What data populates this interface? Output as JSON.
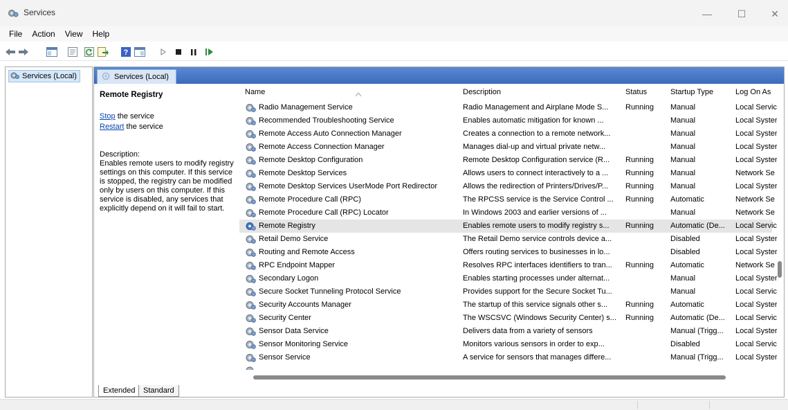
{
  "window": {
    "title": "Services",
    "minimize": "—",
    "maximize": "☐",
    "close": "✕"
  },
  "menu": [
    "File",
    "Action",
    "View",
    "Help"
  ],
  "toolbar_icons": [
    "back-icon",
    "forward-icon",
    "show-hide-console-tree-icon",
    "properties-icon",
    "refresh-icon",
    "export-list-icon",
    "help-icon",
    "show-hide-action-pane-icon",
    "start-service-icon",
    "stop-service-icon",
    "pause-service-icon",
    "resume-service-icon"
  ],
  "tree": {
    "root_label": "Services (Local)"
  },
  "header": {
    "title": "Services (Local)"
  },
  "details": {
    "title": "Remote Registry",
    "stop_link": "Stop",
    "stop_suffix": " the service",
    "restart_link": "Restart",
    "restart_suffix": " the service",
    "description_label": "Description:",
    "description_text": "Enables remote users to modify registry settings on this computer. If this service is stopped, the registry can be modified only by users on this computer. If this service is disabled, any services that explicitly depend on it will fail to start."
  },
  "table": {
    "columns": {
      "name": "Name",
      "description": "Description",
      "status": "Status",
      "startup": "Startup Type",
      "logon": "Log On As"
    },
    "selected_index": 9,
    "rows": [
      {
        "name": "Radio Management Service",
        "description": "Radio Management and Airplane Mode S...",
        "status": "Running",
        "startup": "Manual",
        "logon": "Local Servic"
      },
      {
        "name": "Recommended Troubleshooting Service",
        "description": "Enables automatic mitigation for known ...",
        "status": "",
        "startup": "Manual",
        "logon": "Local Syster"
      },
      {
        "name": "Remote Access Auto Connection Manager",
        "description": "Creates a connection to a remote network...",
        "status": "",
        "startup": "Manual",
        "logon": "Local Syster"
      },
      {
        "name": "Remote Access Connection Manager",
        "description": "Manages dial-up and virtual private netw...",
        "status": "",
        "startup": "Manual",
        "logon": "Local Syster"
      },
      {
        "name": "Remote Desktop Configuration",
        "description": "Remote Desktop Configuration service (R...",
        "status": "Running",
        "startup": "Manual",
        "logon": "Local Syster"
      },
      {
        "name": "Remote Desktop Services",
        "description": "Allows users to connect interactively to a ...",
        "status": "Running",
        "startup": "Manual",
        "logon": "Network Se"
      },
      {
        "name": "Remote Desktop Services UserMode Port Redirector",
        "description": "Allows the redirection of Printers/Drives/P...",
        "status": "Running",
        "startup": "Manual",
        "logon": "Local Syster"
      },
      {
        "name": "Remote Procedure Call (RPC)",
        "description": "The RPCSS service is the Service Control ...",
        "status": "Running",
        "startup": "Automatic",
        "logon": "Network Se"
      },
      {
        "name": "Remote Procedure Call (RPC) Locator",
        "description": "In Windows 2003 and earlier versions of ...",
        "status": "",
        "startup": "Manual",
        "logon": "Network Se"
      },
      {
        "name": "Remote Registry",
        "description": "Enables remote users to modify registry s...",
        "status": "Running",
        "startup": "Automatic (De...",
        "logon": "Local Servic"
      },
      {
        "name": "Retail Demo Service",
        "description": "The Retail Demo service controls device a...",
        "status": "",
        "startup": "Disabled",
        "logon": "Local Syster"
      },
      {
        "name": "Routing and Remote Access",
        "description": "Offers routing services to businesses in lo...",
        "status": "",
        "startup": "Disabled",
        "logon": "Local Syster"
      },
      {
        "name": "RPC Endpoint Mapper",
        "description": "Resolves RPC interfaces identifiers to tran...",
        "status": "Running",
        "startup": "Automatic",
        "logon": "Network Se"
      },
      {
        "name": "Secondary Logon",
        "description": "Enables starting processes under alternat...",
        "status": "",
        "startup": "Manual",
        "logon": "Local Syster"
      },
      {
        "name": "Secure Socket Tunneling Protocol Service",
        "description": "Provides support for the Secure Socket Tu...",
        "status": "",
        "startup": "Manual",
        "logon": "Local Servic"
      },
      {
        "name": "Security Accounts Manager",
        "description": "The startup of this service signals other s...",
        "status": "Running",
        "startup": "Automatic",
        "logon": "Local Syster"
      },
      {
        "name": "Security Center",
        "description": "The WSCSVC (Windows Security Center) s...",
        "status": "Running",
        "startup": "Automatic (De...",
        "logon": "Local Servic"
      },
      {
        "name": "Sensor Data Service",
        "description": "Delivers data from a variety of sensors",
        "status": "",
        "startup": "Manual (Trigg...",
        "logon": "Local Syster"
      },
      {
        "name": "Sensor Monitoring Service",
        "description": "Monitors various sensors in order to exp...",
        "status": "",
        "startup": "Disabled",
        "logon": "Local Servic"
      },
      {
        "name": "Sensor Service",
        "description": "A service for sensors that manages differe...",
        "status": "",
        "startup": "Manual (Trigg...",
        "logon": "Local Syster"
      }
    ]
  },
  "bottom_tabs": [
    "Extended",
    "Standard"
  ],
  "colors": {
    "header_band": "#4a7cc8",
    "selected_row": "#e5e5e5",
    "link": "#0645ad"
  }
}
